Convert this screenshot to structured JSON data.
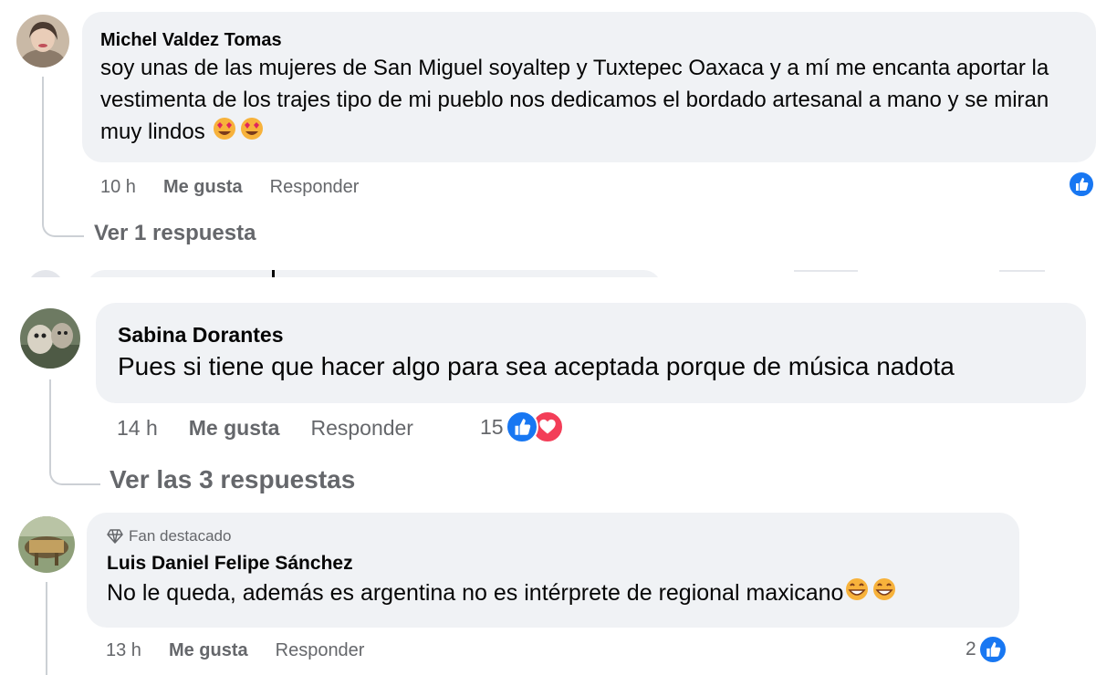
{
  "comments": [
    {
      "author": "Michel Valdez Tomas",
      "text": "soy unas de las mujeres de San Miguel soyaltep y Tuxtepec Oaxaca y a mí me encanta aportar la vestimenta de los trajes tipo de mi pueblo nos dedicamos el bordado artesanal a mano y se miran muy lindos",
      "emoji": "heart-eyes-emoji",
      "time": "10 h",
      "like_label": "Me gusta",
      "reply_label": "Responder",
      "reactions": [
        "like-icon"
      ],
      "replies_label": "Ver 1 respuesta"
    },
    {
      "author": "Sabina Dorantes",
      "text": "Pues si tiene que hacer algo para sea aceptada porque de música nadota",
      "time": "14 h",
      "like_label": "Me gusta",
      "reply_label": "Responder",
      "reaction_count": "15",
      "reactions": [
        "like-icon",
        "heart-icon"
      ],
      "replies_label": "Ver las 3 respuestas"
    },
    {
      "badge": "Fan destacado",
      "badge_icon": "diamond-icon",
      "author": "Luis Daniel Felipe Sánchez",
      "text": "No le queda, además es argentina no es intérprete de regional maxicano",
      "emoji": "grinning-emoji",
      "time": "13 h",
      "like_label": "Me gusta",
      "reply_label": "Responder",
      "reaction_count": "2",
      "reactions": [
        "like-icon"
      ]
    }
  ],
  "colors": {
    "bubble": "#f0f2f5",
    "meta": "#65676b",
    "like": "#1877f2",
    "heart": "#f33e58"
  }
}
